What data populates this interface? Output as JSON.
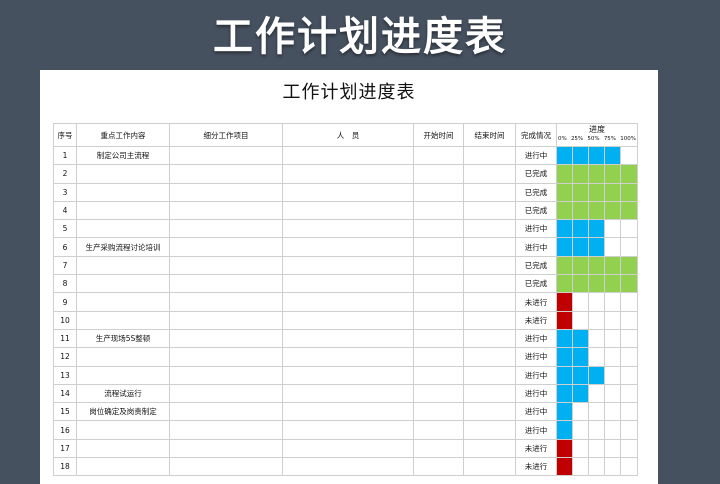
{
  "banner_title": "工作计划进度表",
  "sheet_title": "工作计划进度表",
  "headers": {
    "index": "序号",
    "key_work": "重点工作内容",
    "detail": "细分工作项目",
    "people": "人　员",
    "start": "开始时间",
    "end": "结束时间",
    "status": "完成情况",
    "progress": "进度",
    "progress_ticks": [
      "0%",
      "25%",
      "50%",
      "75%",
      "100%"
    ]
  },
  "colors": {
    "done": "#92d050",
    "in_progress": "#00b0f0",
    "not_started": "#c00000"
  },
  "rows": [
    {
      "index": "1",
      "key_work": "制定公司主流程",
      "status": "进行中",
      "progress": 0.8
    },
    {
      "index": "2",
      "key_work": "",
      "status": "已完成",
      "progress": 1.0
    },
    {
      "index": "3",
      "key_work": "",
      "status": "已完成",
      "progress": 1.0
    },
    {
      "index": "4",
      "key_work": "",
      "status": "已完成",
      "progress": 1.0
    },
    {
      "index": "5",
      "key_work": "",
      "status": "进行中",
      "progress": 0.6
    },
    {
      "index": "6",
      "key_work": "生产采购流程讨论培训",
      "status": "进行中",
      "progress": 0.6
    },
    {
      "index": "7",
      "key_work": "",
      "status": "已完成",
      "progress": 1.0
    },
    {
      "index": "8",
      "key_work": "",
      "status": "已完成",
      "progress": 1.0
    },
    {
      "index": "9",
      "key_work": "",
      "status": "未进行",
      "progress": 0.2
    },
    {
      "index": "10",
      "key_work": "",
      "status": "未进行",
      "progress": 0.2
    },
    {
      "index": "11",
      "key_work": "生产现场5S整顿",
      "status": "进行中",
      "progress": 0.4
    },
    {
      "index": "12",
      "key_work": "",
      "status": "进行中",
      "progress": 0.4
    },
    {
      "index": "13",
      "key_work": "",
      "status": "进行中",
      "progress": 0.6
    },
    {
      "index": "14",
      "key_work": "流程试运行",
      "status": "进行中",
      "progress": 0.4
    },
    {
      "index": "15",
      "key_work": "岗位确定及岗责制定",
      "status": "进行中",
      "progress": 0.2
    },
    {
      "index": "16",
      "key_work": "",
      "status": "进行中",
      "progress": 0.2
    },
    {
      "index": "17",
      "key_work": "",
      "status": "未进行",
      "progress": 0.2
    },
    {
      "index": "18",
      "key_work": "",
      "status": "未进行",
      "progress": 0.2
    }
  ]
}
